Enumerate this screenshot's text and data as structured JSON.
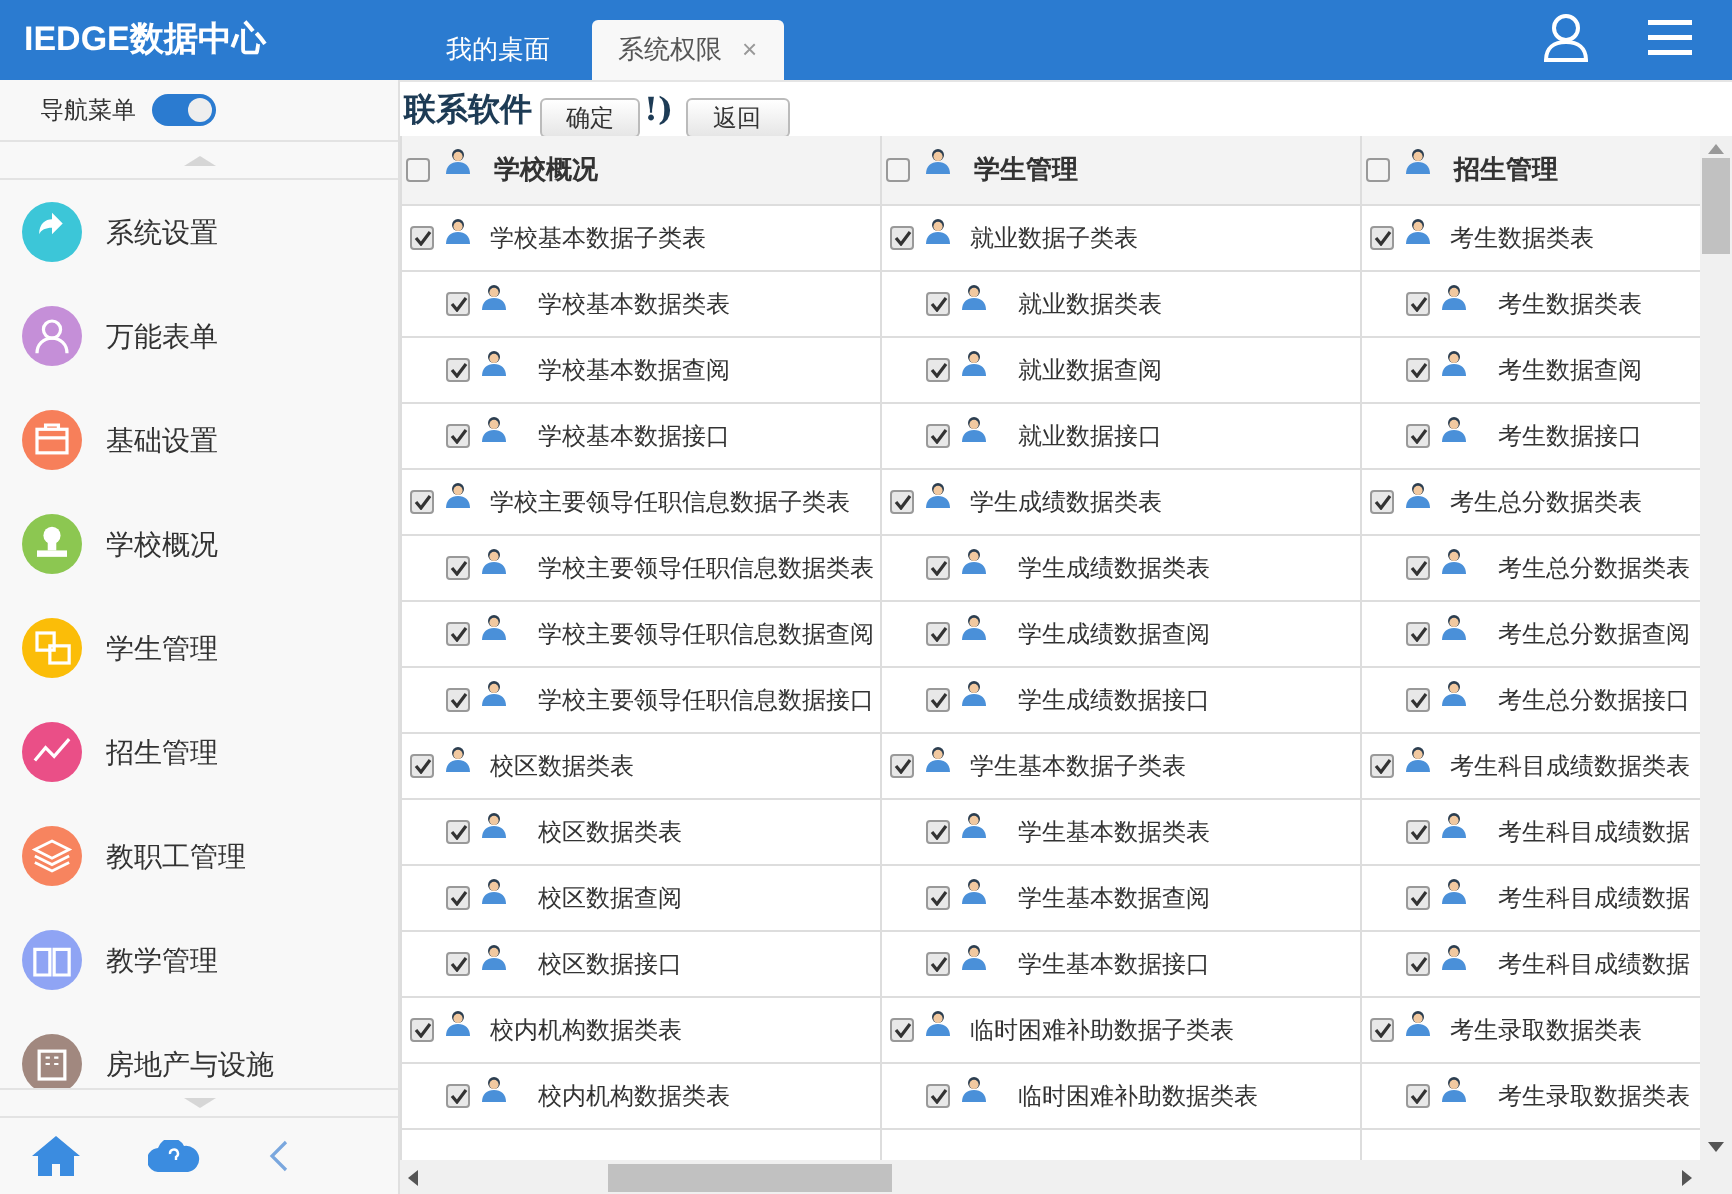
{
  "app_title": "IEDGE数据中心",
  "tabs": [
    {
      "label": "我的桌面",
      "selected": false
    },
    {
      "label": "系统权限",
      "selected": true,
      "close_glyph": "×"
    }
  ],
  "nav_toggle": {
    "label": "导航菜单",
    "on": true
  },
  "sidebar": {
    "items": [
      {
        "label": "系统设置",
        "color": "#3cc6d8"
      },
      {
        "label": "万能表单",
        "color": "#c58fd8"
      },
      {
        "label": "基础设置",
        "color": "#f77f5a"
      },
      {
        "label": "学校概况",
        "color": "#8cc751"
      },
      {
        "label": "学生管理",
        "color": "#fbbd08"
      },
      {
        "label": "招生管理",
        "color": "#ea4f87"
      },
      {
        "label": "教职工管理",
        "color": "#f7845f"
      },
      {
        "label": "教学管理",
        "color": "#8fa4f4"
      },
      {
        "label": "房地产与设施",
        "color": "#a1887f"
      }
    ]
  },
  "heading": {
    "before": "联系软件",
    "after": "!)"
  },
  "buttons": [
    "确定",
    "返回"
  ],
  "columns": [
    {
      "title": "学校概况",
      "checked": false,
      "groups": [
        {
          "label": "学校基本数据子类表",
          "checked": true,
          "children": [
            {
              "label": "学校基本数据类表",
              "checked": true
            },
            {
              "label": "学校基本数据查阅",
              "checked": true
            },
            {
              "label": "学校基本数据接口",
              "checked": true
            }
          ]
        },
        {
          "label": "学校主要领导任职信息数据子类表",
          "checked": true,
          "children": [
            {
              "label": "学校主要领导任职信息数据类表",
              "checked": true
            },
            {
              "label": "学校主要领导任职信息数据查阅",
              "checked": true
            },
            {
              "label": "学校主要领导任职信息数据接口",
              "checked": true
            }
          ]
        },
        {
          "label": "校区数据类表",
          "checked": true,
          "children": [
            {
              "label": "校区数据类表",
              "checked": true
            },
            {
              "label": "校区数据查阅",
              "checked": true
            },
            {
              "label": "校区数据接口",
              "checked": true
            }
          ]
        },
        {
          "label": "校内机构数据类表",
          "checked": true,
          "children": [
            {
              "label": "校内机构数据类表",
              "checked": true
            }
          ]
        }
      ]
    },
    {
      "title": "学生管理",
      "checked": false,
      "groups": [
        {
          "label": "就业数据子类表",
          "checked": true,
          "children": [
            {
              "label": "就业数据类表",
              "checked": true
            },
            {
              "label": "就业数据查阅",
              "checked": true
            },
            {
              "label": "就业数据接口",
              "checked": true
            }
          ]
        },
        {
          "label": "学生成绩数据类表",
          "checked": true,
          "children": [
            {
              "label": "学生成绩数据类表",
              "checked": true
            },
            {
              "label": "学生成绩数据查阅",
              "checked": true
            },
            {
              "label": "学生成绩数据接口",
              "checked": true
            }
          ]
        },
        {
          "label": "学生基本数据子类表",
          "checked": true,
          "children": [
            {
              "label": "学生基本数据类表",
              "checked": true
            },
            {
              "label": "学生基本数据查阅",
              "checked": true
            },
            {
              "label": "学生基本数据接口",
              "checked": true
            }
          ]
        },
        {
          "label": "临时困难补助数据子类表",
          "checked": true,
          "children": [
            {
              "label": "临时困难补助数据类表",
              "checked": true
            }
          ]
        }
      ]
    },
    {
      "title": "招生管理",
      "checked": false,
      "groups": [
        {
          "label": "考生数据类表",
          "checked": true,
          "children": [
            {
              "label": "考生数据类表",
              "checked": true
            },
            {
              "label": "考生数据查阅",
              "checked": true
            },
            {
              "label": "考生数据接口",
              "checked": true
            }
          ]
        },
        {
          "label": "考生总分数据类表",
          "checked": true,
          "children": [
            {
              "label": "考生总分数据类表",
              "checked": true
            },
            {
              "label": "考生总分数据查阅",
              "checked": true
            },
            {
              "label": "考生总分数据接口",
              "checked": true
            }
          ]
        },
        {
          "label": "考生科目成绩数据类表",
          "checked": true,
          "children": [
            {
              "label": "考生科目成绩数据",
              "checked": true
            },
            {
              "label": "考生科目成绩数据",
              "checked": true
            },
            {
              "label": "考生科目成绩数据",
              "checked": true
            }
          ]
        },
        {
          "label": "考生录取数据类表",
          "checked": true,
          "children": [
            {
              "label": "考生录取数据类表",
              "checked": true
            }
          ]
        }
      ]
    }
  ]
}
